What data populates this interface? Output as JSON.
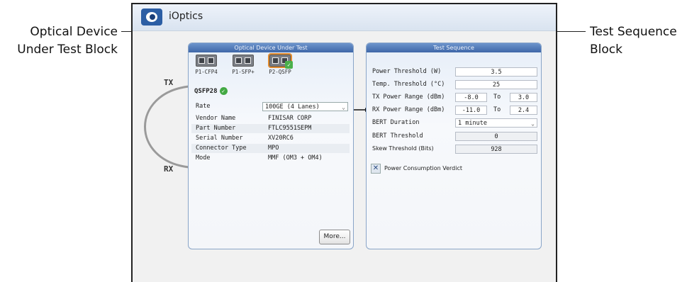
{
  "callouts": {
    "left_line1": "Optical Device",
    "left_line2": "Under Test Block",
    "right_line1": "Test Sequence",
    "right_line2": "Block"
  },
  "app": {
    "title": "iOptics",
    "logo_icon": "eye-logo-icon"
  },
  "labels": {
    "tx": "TX",
    "rx": "RX"
  },
  "dut": {
    "header": "Optical Device Under Test",
    "modules": [
      {
        "label": "P1-CFP4",
        "selected": false
      },
      {
        "label": "P1-SFP+",
        "selected": false
      },
      {
        "label": "P2-QSFP",
        "selected": true
      }
    ],
    "detected": "QSFP28",
    "rate_label": "Rate",
    "rate_value": "100GE (4 Lanes)",
    "rows": [
      {
        "label": "Vendor Name",
        "value": "FINISAR CORP"
      },
      {
        "label": "Part Number",
        "value": "FTLC9551SEPM"
      },
      {
        "label": "Serial Number",
        "value": "XV20RC6"
      },
      {
        "label": "Connector Type",
        "value": "MPO"
      },
      {
        "label": "Mode",
        "value": "MMF (OM3 + OM4)"
      }
    ],
    "more_button": "More..."
  },
  "seq": {
    "header": "Test Sequence",
    "power_threshold": {
      "label": "Power Threshold (W)",
      "value": "3.5"
    },
    "temp_threshold": {
      "label": "Temp. Threshold (°C)",
      "value": "25"
    },
    "tx_range": {
      "label": "TX Power Range (dBm)",
      "min": "-8.0",
      "to": "To",
      "max": "3.0"
    },
    "rx_range": {
      "label": "RX Power Range (dBm)",
      "min": "-11.0",
      "to": "To",
      "max": "2.4"
    },
    "bert_duration": {
      "label": "BERT Duration",
      "value": "1 minute"
    },
    "bert_threshold": {
      "label": "BERT Threshold",
      "value": "0"
    },
    "skew_threshold": {
      "label": "Skew Threshold (Bits)",
      "value": "928"
    },
    "power_verdict": {
      "label": "Power Consumption Verdict",
      "checked": true
    }
  },
  "colors": {
    "header_blue": "#4a73b3",
    "frame": "#222222",
    "selected_outline": "#e08a2e",
    "verified_green": "#43a943"
  }
}
